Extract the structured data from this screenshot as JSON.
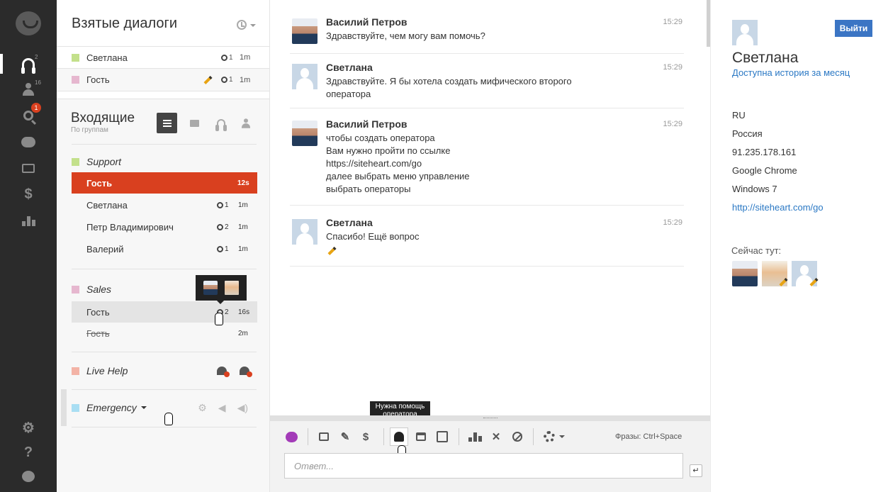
{
  "rail": {
    "items": [
      {
        "name": "operator-dialogs",
        "count": "2"
      },
      {
        "name": "visitors",
        "count": "16"
      },
      {
        "name": "search",
        "badge": "1"
      },
      {
        "name": "chats"
      },
      {
        "name": "mail"
      },
      {
        "name": "billing"
      },
      {
        "name": "stats"
      }
    ],
    "bottom": [
      "settings",
      "help",
      "logo"
    ]
  },
  "taken": {
    "title": "Взятые диалоги",
    "rows": [
      {
        "name": "Светлана",
        "color": "#c3e08b",
        "ops": "1",
        "time": "1m"
      },
      {
        "name": "Гость",
        "color": "#e6b7cf",
        "ops": "1",
        "time": "1m"
      }
    ]
  },
  "incoming": {
    "title": "Входящие",
    "subtitle": "По группам",
    "groups": [
      {
        "name": "Support",
        "color": "#c3e08b",
        "rows": [
          {
            "name": "Гость",
            "time": "12s"
          },
          {
            "name": "Светлана",
            "ops": "1",
            "time": "1m"
          },
          {
            "name": "Петр Владимирович",
            "ops": "2",
            "time": "1m"
          },
          {
            "name": "Валерий",
            "ops": "1",
            "time": "1m"
          }
        ]
      },
      {
        "name": "Sales",
        "color": "#e6b7cf",
        "rows": [
          {
            "name": "Гость",
            "ops": "2",
            "time": "16s"
          },
          {
            "name": "Гость",
            "time": "2m"
          }
        ]
      },
      {
        "name": "Live Help",
        "color": "#f3b3a6"
      },
      {
        "name": "Emergency",
        "color": "#a9def3"
      }
    ]
  },
  "messages": [
    {
      "author": "Василий Петров",
      "time": "15:29",
      "text": "Здравствуйте, чем могу вам помочь?"
    },
    {
      "author": "Светлана",
      "time": "15:29",
      "text": "Здравствуйте. Я бы хотела создать мифического второго\nоператора"
    },
    {
      "author": "Василий Петров",
      "time": "15:29",
      "text": "чтобы создать оператора\nВам нужно пройти по ссылке\nhttps://siteheart.com/go\nдалее выбрать меню управление\nвыбрать операторы"
    },
    {
      "author": "Светлана",
      "time": "15:29",
      "text": "Спасибо! Ещё вопрос"
    }
  ],
  "toolbar": {
    "help_tooltip": "Нужна помощь оператора",
    "phrases_hint": "Фразы: Ctrl+Space",
    "reply_placeholder": "Ответ..."
  },
  "visitor": {
    "name": "Светлана",
    "history_link": "Доступна история за месяц",
    "logout": "Выйти",
    "country_code": "RU",
    "country": "Россия",
    "ip": "91.235.178.161",
    "browser": "Google Chrome",
    "os": "Windows 7",
    "url": "http://siteheart.com/go",
    "here_label": "Сейчас тут:"
  },
  "colors": {
    "accent": "#d9401f",
    "link": "#2a78c4",
    "button": "#3b75c4",
    "rail": "#2b2b2b"
  }
}
